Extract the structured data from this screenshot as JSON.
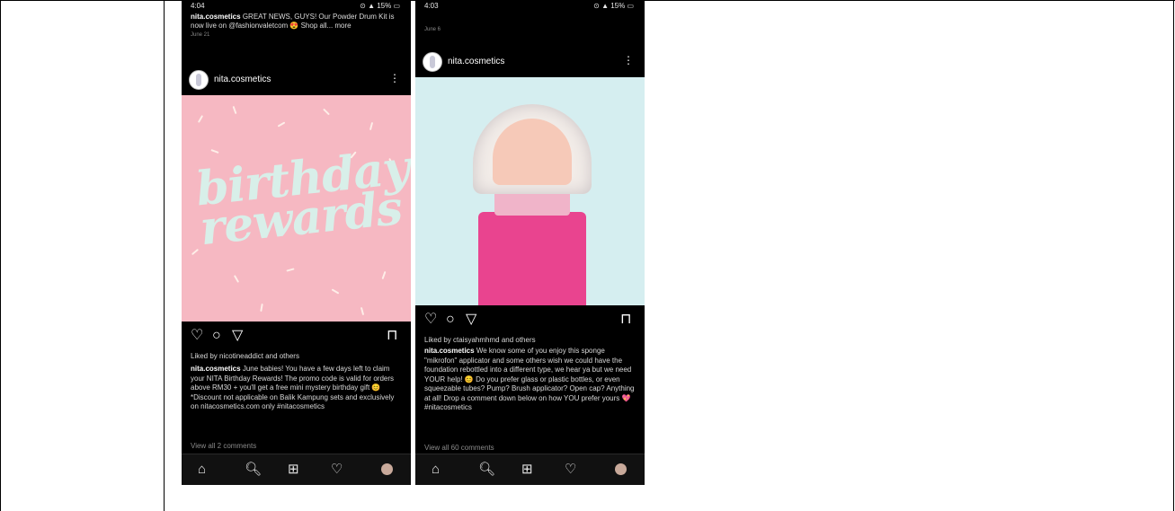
{
  "phone1": {
    "status_time": "4:04",
    "status_icons": "⊙ ▲ 15% ▭",
    "top_caption_user": "nita.cosmetics",
    "top_caption_text": "GREAT NEWS, GUYS! Our Powder Drum Kit is now live on @fashionvaletcom 😍 Shop all... more",
    "top_caption_date": "June 21",
    "username": "nita.cosmetics",
    "kebab": "⋮",
    "image_line1": "birthday",
    "image_line2": "rewards",
    "liked_text": "Liked by nicotineaddict and others",
    "caption_user": "nita.cosmetics",
    "caption_text": "June babies! You have a few days left to claim your NITA Birthday Rewards! The promo code is valid for orders above RM30 + you'll get a free mini mystery birthday gift 😊 *Discount not applicable on Balik Kampung sets and exclusively on nitacosmetics.com only #nitacosmetics",
    "view_comments": "View all 2 comments"
  },
  "phone2": {
    "status_time": "4:03",
    "status_icons": "⊙ ▲ 15% ▭",
    "top_date": "June 6",
    "username": "nita.cosmetics",
    "kebab": "⋮",
    "liked_text": "Liked by ctaisyahmhmd and others",
    "caption_user": "nita.cosmetics",
    "caption_text": "We know some of you enjoy this sponge \"mikrofon\" applicator and some others wish we could have the foundation rebottled into a different type, we hear ya but we need YOUR help! 😊 Do you prefer glass or plastic bottles, or even squeezable tubes? Pump? Brush applicator? Open cap? Anything at all! Drop a comment down below on how YOU prefer yours 💖 #nitacosmetics",
    "view_comments": "View all 60 comments"
  },
  "icons": {
    "like": "♡",
    "comment": "○",
    "share": "▽",
    "save": "⊓",
    "home": "⌂",
    "search": "🔍︎",
    "add": "⊞",
    "heart": "♡"
  },
  "colors": {
    "pink_background": "#f6b8c2",
    "teal_background": "#d5eef0",
    "bottle_pink": "#e9448f"
  }
}
